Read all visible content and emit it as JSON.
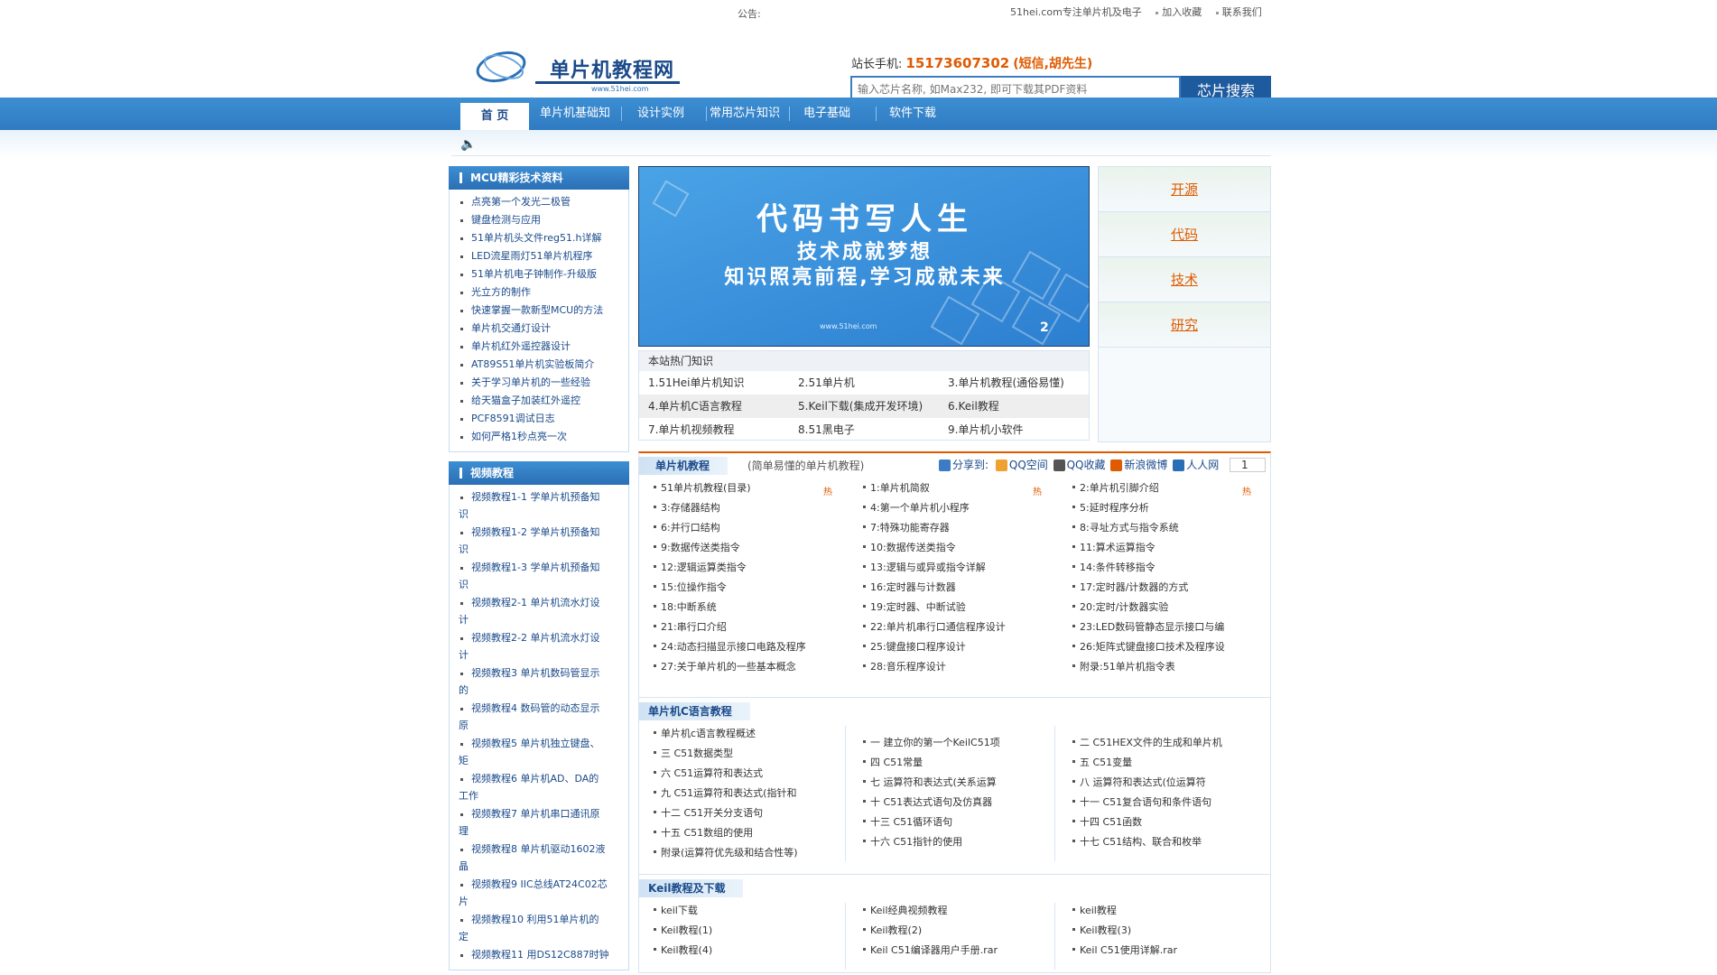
{
  "topbar": {
    "notice_label": "公告:",
    "site_desc": "51hei.com专注单片机及电子",
    "favorite": "加入收藏",
    "contact_us": "联系我们"
  },
  "logo": {
    "title": "单片机教程网",
    "sub": "www.51hei.com"
  },
  "contact": {
    "label": "站长手机:",
    "phone": "15173607302",
    "note": "(短信,胡先生)"
  },
  "search": {
    "placeholder": "输入芯片名称, 如Max232, 即可下载其PDF资料",
    "button": "芯片搜索"
  },
  "nav": {
    "items": [
      "首 页",
      "单片机基础知",
      "设计实例",
      "常用芯片知识",
      "电子基础",
      "软件下载"
    ]
  },
  "left": {
    "mcu_title": "MCU精彩技术资料",
    "mcu_items": [
      "点亮第一个发光二极管",
      "键盘检测与应用",
      "51单片机头文件reg51.h详解",
      "LED流星雨灯51单片机程序",
      "51单片机电子钟制作-升级版",
      "光立方的制作",
      "快速掌握一款新型MCU的方法",
      "单片机交通灯设计",
      "单片机红外遥控器设计",
      "AT89S51单片机实验板简介",
      "关于学习单片机的一些经验",
      "给天猫盒子加装红外遥控",
      "PCF8591调试日志",
      "如何严格1秒点亮一次"
    ],
    "video_title": "视频教程",
    "video_items": [
      [
        "视频教程1-1 学单片机预备知",
        "识"
      ],
      [
        "视频教程1-2 学单片机预备知",
        "识"
      ],
      [
        "视频教程1-3 学单片机预备知",
        "识"
      ],
      [
        "视频教程2-1 单片机流水灯设",
        "计"
      ],
      [
        "视频教程2-2 单片机流水灯设",
        "计"
      ],
      [
        "视频教程3 单片机数码管显示",
        "的"
      ],
      [
        "视频教程4 数码管的动态显示",
        "原"
      ],
      [
        "视频教程5 单片机独立键盘、",
        "矩"
      ],
      [
        "视频教程6 单片机AD、DA的",
        "工作"
      ],
      [
        "视频教程7 单片机串口通讯原",
        "理"
      ],
      [
        "视频教程8 单片机驱动1602液",
        "晶"
      ],
      [
        "视频教程9 IIC总线AT24C02芯",
        "片"
      ],
      [
        "视频教程10 利用51单片机的",
        "定"
      ],
      [
        "视频教程11 用DS12C887时钟",
        ""
      ]
    ]
  },
  "banner": {
    "line1": "代码书写人生",
    "line2": "技术成就梦想",
    "line3": "知识照亮前程,学习成就未来",
    "url": "www.51hei.com",
    "slide": "2"
  },
  "hot": {
    "title": "本站热门知识",
    "rows": [
      [
        "1.51Hei单片机知识",
        "2.51单片机",
        "3.单片机教程(通俗易懂)"
      ],
      [
        "4.单片机C语言教程",
        "5.Keil下载(集成开发环境)",
        "6.Keil教程"
      ],
      [
        "7.单片机视频教程",
        "8.51黑电子",
        "9.单片机小软件"
      ]
    ]
  },
  "tags": [
    "开源",
    "代码",
    "技术",
    "研究"
  ],
  "tutorial": {
    "tab": "单片机教程",
    "desc": "(简单易懂的单片机教程)",
    "share_label": "分享到:",
    "share_items": [
      "QQ空间",
      "QQ收藏",
      "新浪微博",
      "人人网"
    ],
    "share_count": "1",
    "hot_mark": "热",
    "col1": [
      "51单片机教程(目录)",
      "3:存储器结构",
      "6:并行口结构",
      "9:数据传送类指令",
      "12:逻辑运算类指令",
      "15:位操作指令",
      "18:中断系统",
      "21:串行口介绍",
      "24:动态扫描显示接口电路及程序",
      "27:关于单片机的一些基本概念"
    ],
    "col2": [
      "1:单片机简叙",
      "4:第一个单片机小程序",
      "7:特殊功能寄存器",
      "10:数据传送类指令",
      "13:逻辑与或异或指令详解",
      "16:定时器与计数器",
      "19:定时器、中断试验",
      "22:单片机串行口通信程序设计",
      "25:键盘接口程序设计",
      "28:音乐程序设计"
    ],
    "col3": [
      "2:单片机引脚介绍",
      "5:延时程序分析",
      "8:寻址方式与指令系统",
      "11:算术运算指令",
      "14:条件转移指令",
      "17:定时器/计数器的方式",
      "20:定时/计数器实验",
      "23:LED数码管静态显示接口与编",
      "26:矩阵式键盘接口技术及程序设",
      "附录:51单片机指令表"
    ]
  },
  "c51": {
    "tab": "单片机C语言教程",
    "col1": [
      "单片机c语言教程概述",
      "三 C51数据类型",
      "六 C51运算符和表达式",
      "九 C51运算符和表达式(指针和",
      "十二 C51开关分支语句",
      "十五 C51数组的使用",
      "附录(运算符优先级和结合性等)"
    ],
    "col2": [
      "一 建立你的第一个KeilC51项",
      "四 C51常量",
      "七 运算符和表达式(关系运算",
      "十 C51表达式语句及仿真器",
      "十三 C51循环语句",
      "十六 C51指针的使用"
    ],
    "col3": [
      "二 C51HEX文件的生成和单片机",
      "五 C51变量",
      "八 运算符和表达式(位运算符",
      "十一 C51复合语句和条件语句",
      "十四 C51函数",
      "十七 C51结构、联合和枚举"
    ]
  },
  "keil": {
    "tab": "Keil教程及下载",
    "col1": [
      "keil下载",
      "Keil教程(1)",
      "Keil教程(4)"
    ],
    "col2": [
      "Keil经典视频教程",
      "Keil教程(2)",
      "Keil C51编译器用户手册.rar"
    ],
    "col3": [
      "keil教程",
      "Keil教程(3)",
      "Keil C51使用详解.rar"
    ]
  }
}
